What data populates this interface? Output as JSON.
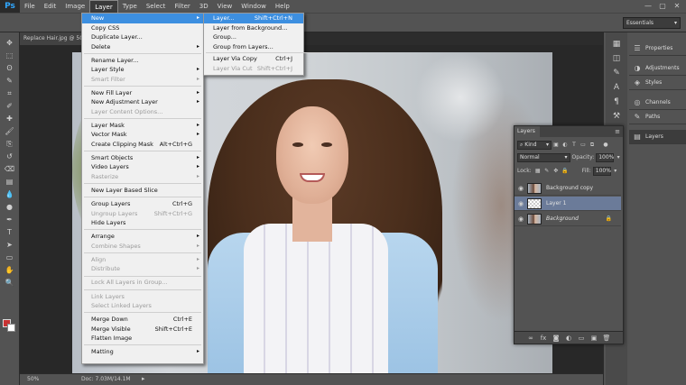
{
  "app": {
    "logo": "Ps"
  },
  "menubar": {
    "items": [
      "File",
      "Edit",
      "Image",
      "Layer",
      "Type",
      "Select",
      "Filter",
      "3D",
      "View",
      "Window",
      "Help"
    ],
    "active": "Layer",
    "window_controls": [
      "—",
      "▢",
      "✕"
    ]
  },
  "options": {
    "workspace": "Essentials"
  },
  "document": {
    "tab_label": "Replace Hair.jpg @ 50"
  },
  "status": {
    "zoom": "50%",
    "doc_size": "Doc: 7.03M/14.1M",
    "arrow": "▸"
  },
  "tools": {
    "icons": [
      "move-icon",
      "marquee-icon",
      "lasso-icon",
      "quick-select-icon",
      "crop-icon",
      "eyedropper-icon",
      "healing-brush-icon",
      "brush-icon",
      "clone-stamp-icon",
      "history-brush-icon",
      "eraser-icon",
      "gradient-icon",
      "blur-icon",
      "dodge-icon",
      "pen-icon",
      "type-icon",
      "path-select-icon",
      "shape-icon",
      "hand-icon",
      "zoom-icon"
    ],
    "glyphs": [
      "✥",
      "⬚",
      "ʘ",
      "✎",
      "⌗",
      "✐",
      "✚",
      "🖌",
      "⎘",
      "↺",
      "⌫",
      "▤",
      "💧",
      "●",
      "✒",
      "T",
      "➤",
      "▭",
      "✋",
      "🔍"
    ],
    "foreground_color": "#c83232",
    "background_color": "#ffffff"
  },
  "dock": {
    "items": [
      {
        "label": "Properties",
        "icon": "properties-icon"
      },
      {
        "label": "Adjustments",
        "icon": "adjustments-icon"
      },
      {
        "label": "Styles",
        "icon": "styles-icon"
      },
      {
        "label": "Channels",
        "icon": "channels-icon"
      },
      {
        "label": "Paths",
        "icon": "paths-icon"
      },
      {
        "label": "Layers",
        "icon": "layers-icon"
      }
    ]
  },
  "layers_panel": {
    "tab": "Layers",
    "menu_glyph": "≡",
    "kind_label": "Kind",
    "blend_mode": "Normal",
    "opacity_label": "Opacity:",
    "opacity_value": "100%",
    "lock_label": "Lock:",
    "fill_label": "Fill:",
    "fill_value": "100%",
    "layers": [
      {
        "name": "Background copy",
        "thumb": "photo",
        "selected": false,
        "locked": false
      },
      {
        "name": "Layer 1",
        "thumb": "checker",
        "selected": true,
        "locked": false
      },
      {
        "name": "Background",
        "thumb": "photo",
        "selected": false,
        "locked": true
      }
    ],
    "footer_icons": [
      "link-icon",
      "fx-icon",
      "mask-icon",
      "adjustment-layer-icon",
      "group-icon",
      "new-layer-icon",
      "trash-icon"
    ]
  },
  "layer_menu": {
    "items": [
      {
        "label": "New",
        "submenu": true,
        "highlighted": true
      },
      {
        "label": "Copy CSS"
      },
      {
        "label": "Duplicate Layer..."
      },
      {
        "label": "Delete",
        "submenu": true
      },
      {
        "sep": true
      },
      {
        "label": "Rename Layer..."
      },
      {
        "label": "Layer Style",
        "submenu": true
      },
      {
        "label": "Smart Filter",
        "disabled": true,
        "submenu": true
      },
      {
        "sep": true
      },
      {
        "label": "New Fill Layer",
        "submenu": true
      },
      {
        "label": "New Adjustment Layer",
        "submenu": true
      },
      {
        "label": "Layer Content Options...",
        "disabled": true
      },
      {
        "sep": true
      },
      {
        "label": "Layer Mask",
        "submenu": true
      },
      {
        "label": "Vector Mask",
        "submenu": true
      },
      {
        "label": "Create Clipping Mask",
        "shortcut": "Alt+Ctrl+G"
      },
      {
        "sep": true
      },
      {
        "label": "Smart Objects",
        "submenu": true
      },
      {
        "label": "Video Layers",
        "submenu": true
      },
      {
        "label": "Rasterize",
        "disabled": true,
        "submenu": true
      },
      {
        "sep": true
      },
      {
        "label": "New Layer Based Slice"
      },
      {
        "sep": true
      },
      {
        "label": "Group Layers",
        "shortcut": "Ctrl+G"
      },
      {
        "label": "Ungroup Layers",
        "shortcut": "Shift+Ctrl+G",
        "disabled": true
      },
      {
        "label": "Hide Layers"
      },
      {
        "sep": true
      },
      {
        "label": "Arrange",
        "submenu": true
      },
      {
        "label": "Combine Shapes",
        "disabled": true,
        "submenu": true
      },
      {
        "sep": true
      },
      {
        "label": "Align",
        "disabled": true,
        "submenu": true
      },
      {
        "label": "Distribute",
        "disabled": true,
        "submenu": true
      },
      {
        "sep": true
      },
      {
        "label": "Lock All Layers in Group...",
        "disabled": true
      },
      {
        "sep": true
      },
      {
        "label": "Link Layers",
        "disabled": true
      },
      {
        "label": "Select Linked Layers",
        "disabled": true
      },
      {
        "sep": true
      },
      {
        "label": "Merge Down",
        "shortcut": "Ctrl+E"
      },
      {
        "label": "Merge Visible",
        "shortcut": "Shift+Ctrl+E"
      },
      {
        "label": "Flatten Image"
      },
      {
        "sep": true
      },
      {
        "label": "Matting",
        "submenu": true
      }
    ]
  },
  "new_submenu": {
    "items": [
      {
        "label": "Layer...",
        "shortcut": "Shift+Ctrl+N",
        "highlighted": true
      },
      {
        "label": "Layer from Background..."
      },
      {
        "label": "Group..."
      },
      {
        "label": "Group from Layers..."
      },
      {
        "sep": true
      },
      {
        "label": "Layer Via Copy",
        "shortcut": "Ctrl+J"
      },
      {
        "label": "Layer Via Cut",
        "shortcut": "Shift+Ctrl+J",
        "disabled": true
      }
    ]
  }
}
